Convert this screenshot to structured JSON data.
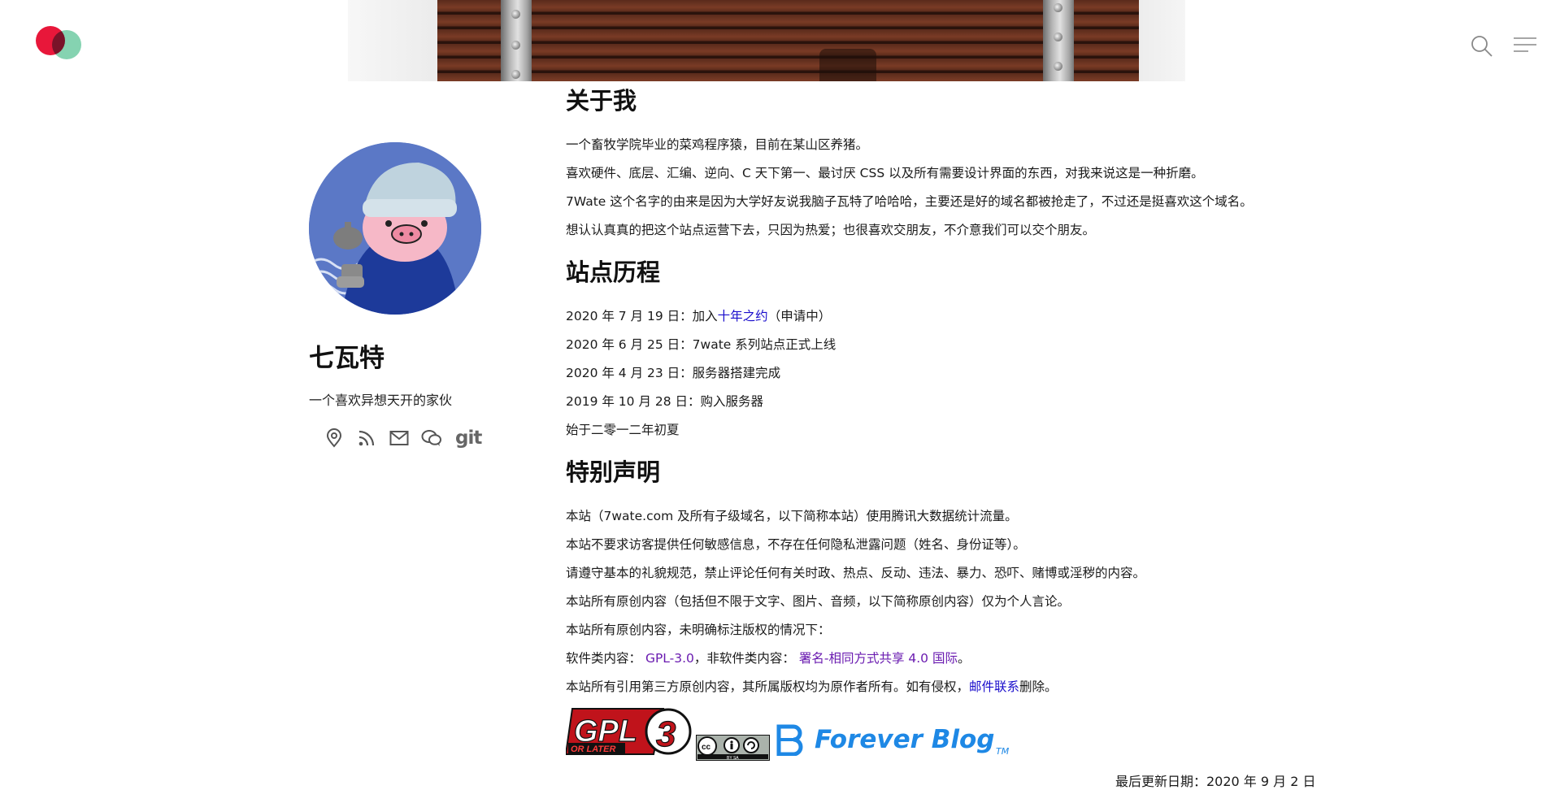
{
  "header": {
    "logo_icon": "two-overlapping-circles-logo",
    "search_icon": "search-icon",
    "menu_icon": "hamburger-menu-icon",
    "colors": {
      "logo_red": "#e8173a",
      "logo_green": "#5cc497"
    }
  },
  "profile": {
    "name": "七瓦特",
    "bio": "一个喜欢异想天开的家伙",
    "social_icons": [
      "location-pin-icon",
      "rss-icon",
      "mail-icon",
      "wechat-icon",
      "git-icon"
    ],
    "git_label": "git"
  },
  "about": {
    "title": "关于我",
    "paragraphs": [
      "一个畜牧学院毕业的菜鸡程序猿，目前在某山区养猪。",
      "喜欢硬件、底层、汇编、逆向、C 天下第一、最讨厌 CSS 以及所有需要设计界面的东西，对我来说这是一种折磨。",
      "7Wate 这个名字的由来是因为大学好友说我脑子瓦特了哈哈哈，主要还是好的域名都被抢走了，不过还是挺喜欢这个域名。",
      "想认认真真的把这个站点运营下去，只因为热爱；也很喜欢交朋友，不介意我们可以交个朋友。"
    ]
  },
  "history": {
    "title": "站点历程",
    "item1_prefix": "2020 年 7 月 19 日：加入",
    "item1_link": "十年之约",
    "item1_suffix": "（申请中）",
    "items": [
      "2020 年 6 月 25 日：7wate 系列站点正式上线",
      "2020 年 4 月 23 日：服务器搭建完成",
      "2019 年 10 月 28 日：购入服务器",
      "始于二零一二年初夏"
    ]
  },
  "notice": {
    "title": "特别声明",
    "paragraphs": [
      "本站（7wate.com 及所有子级域名，以下简称本站）使用腾讯大数据统计流量。",
      "本站不要求访客提供任何敏感信息，不存在任何隐私泄露问题（姓名、身份证等）。",
      "请遵守基本的礼貌规范，禁止评论任何有关时政、热点、反动、违法、暴力、恐吓、赌博或淫秽的内容。",
      "本站所有原创内容（包括但不限于文字、图片、音频，以下简称原创内容）仅为个人言论。",
      "本站所有原创内容，未明确标注版权的情况下："
    ],
    "license_prefix": "软件类内容：",
    "license_software": "GPL-3.0",
    "license_middle": "，非软件类内容：",
    "license_other": "署名-相同方式共享 4.0 国际",
    "license_suffix": "。",
    "third_party_prefix": "本站所有引用第三方原创内容，其所属版权均为原作者所有。如有侵权，",
    "third_party_link": "邮件联系",
    "third_party_suffix": "删除。"
  },
  "badges": {
    "gpl_text": "GPL",
    "gpl_version": "3",
    "gpl_sub": "OR LATER",
    "cc_sub": "BY   SA",
    "forever_blog": "Forever Blog",
    "forever_blog_tm": "TM"
  },
  "footer": {
    "updated": "最后更新日期：2020 年 9 月 2 日"
  },
  "colors": {
    "link_blue": "#1a0dcc",
    "link_purple": "#6a1bb0",
    "forever_blue": "#1e88e5",
    "gpl_red": "#c0131b"
  }
}
